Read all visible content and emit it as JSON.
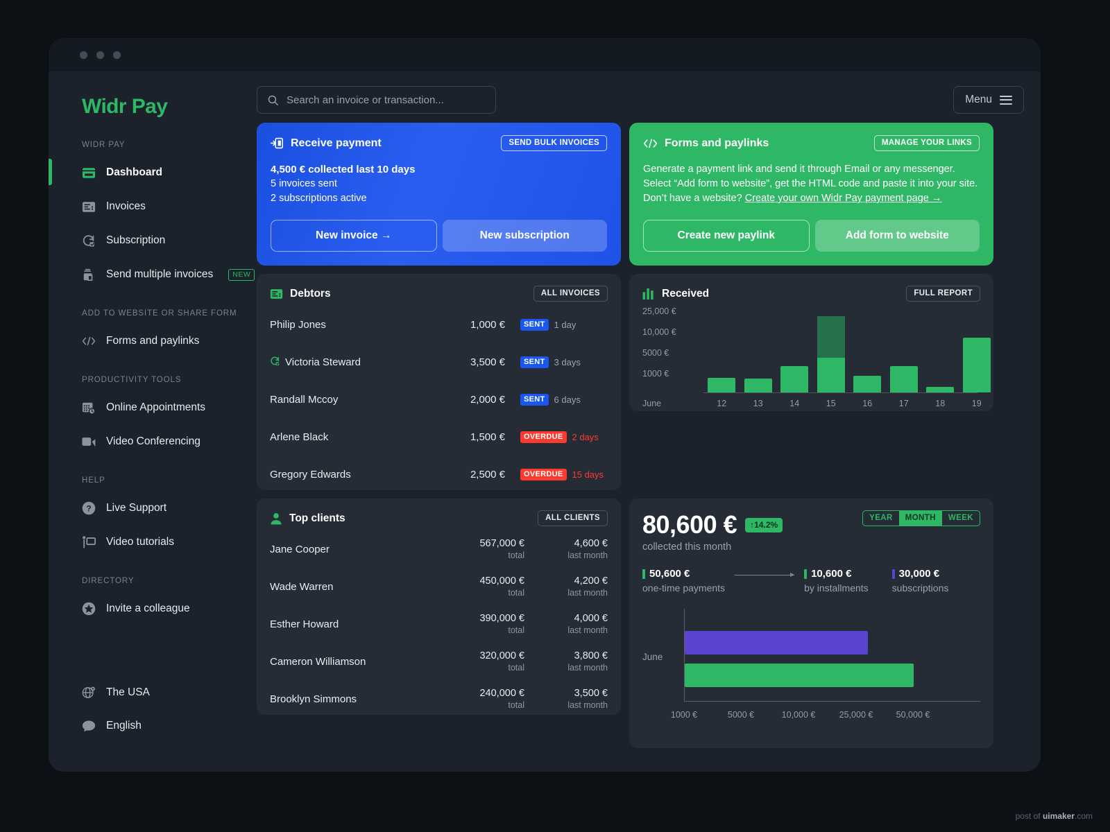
{
  "brand": {
    "name": "Widr Pay",
    "accent": "#2eb765",
    "blue": "#1a56f0",
    "red": "#fb3b30",
    "purple": "#5b45cf"
  },
  "search": {
    "placeholder": "Search an invoice or transaction...",
    "value": "",
    "icon": "search-icon"
  },
  "menu": {
    "label": "Menu",
    "icon": "hamburger-icon"
  },
  "sidebar": {
    "groups": [
      {
        "label": "WIDR PAY",
        "items": [
          {
            "label": "Dashboard",
            "icon": "dashboard-card-icon",
            "active": true,
            "badge": ""
          },
          {
            "label": "Invoices",
            "icon": "invoice-icon",
            "active": false,
            "badge": ""
          },
          {
            "label": "Subscription",
            "icon": "refresh-check-icon",
            "active": false,
            "badge": ""
          },
          {
            "label": "Send multiple invoices",
            "icon": "bulk-send-icon",
            "active": false,
            "badge": "NEW"
          }
        ]
      },
      {
        "label": "ADD TO WEBSITE OR SHARE FORM",
        "items": [
          {
            "label": "Forms and paylinks",
            "icon": "code-brackets-icon",
            "active": false,
            "badge": ""
          }
        ]
      },
      {
        "label": "PRODUCTIVITY TOOLS",
        "items": [
          {
            "label": "Online Appointments",
            "icon": "calendar-clock-icon",
            "active": false,
            "badge": ""
          },
          {
            "label": "Video Conferencing",
            "icon": "video-camera-icon",
            "active": false,
            "badge": ""
          }
        ]
      },
      {
        "label": "HELP",
        "items": [
          {
            "label": "Live Support",
            "icon": "question-circle-icon",
            "active": false,
            "badge": ""
          },
          {
            "label": "Video tutorials",
            "icon": "presenter-board-icon",
            "active": false,
            "badge": ""
          }
        ]
      },
      {
        "label": "DIRECTORY",
        "items": [
          {
            "label": "Invite a colleague",
            "icon": "star-circle-icon",
            "active": false,
            "badge": ""
          }
        ]
      }
    ],
    "footer": [
      {
        "label": "The USA",
        "icon": "globe-pin-icon"
      },
      {
        "label": "English",
        "icon": "speech-bubble-icon"
      }
    ]
  },
  "receive_payment": {
    "title": "Receive payment",
    "icon": "receive-payment-icon",
    "action_label": "SEND BULK INVOICES",
    "headline": "4,500 € collected last 10 days",
    "line2": "5 invoices sent",
    "line3": "2 subscriptions active",
    "primary_label": "New invoice →",
    "secondary_label": "New subscription"
  },
  "forms_paylinks": {
    "title": "Forms and paylinks",
    "icon": "code-brackets-icon",
    "action_label": "MANAGE YOUR LINKS",
    "line1": "Generate a payment link and send it through Email or any messenger.",
    "line2": "Select “Add form to website”, get the HTML code and paste it into your site.",
    "line3_prefix": "Don’t have a website? ",
    "line3_link": "Create your own Widr Pay payment page →",
    "primary_label": "Create new paylink",
    "secondary_label": "Add form to website"
  },
  "debtors": {
    "title": "Debtors",
    "icon": "invoice-icon",
    "action_label": "ALL INVOICES",
    "rows": [
      {
        "name": "Philip Jones",
        "amount": "1,000 €",
        "status": "SENT",
        "status_kind": "sent",
        "age": "1 day",
        "recurring": false
      },
      {
        "name": "Victoria Steward",
        "amount": "3,500 €",
        "status": "SENT",
        "status_kind": "sent",
        "age": "3 days",
        "recurring": true
      },
      {
        "name": "Randall Mccoy",
        "amount": "2,000 €",
        "status": "SENT",
        "status_kind": "sent",
        "age": "6 days",
        "recurring": false
      },
      {
        "name": "Arlene Black",
        "amount": "1,500 €",
        "status": "OVERDUE",
        "status_kind": "overdue",
        "age": "2 days",
        "recurring": false
      },
      {
        "name": "Gregory Edwards",
        "amount": "2,500 €",
        "status": "OVERDUE",
        "status_kind": "overdue",
        "age": "15 days",
        "recurring": false
      }
    ]
  },
  "top_clients": {
    "title": "Top clients",
    "icon": "person-icon",
    "action_label": "ALL CLIENTS",
    "total_caption": "total",
    "last_month_caption": "last month",
    "rows": [
      {
        "name": "Jane Cooper",
        "total": "567,000 €",
        "last_month": "4,600 €"
      },
      {
        "name": "Wade Warren",
        "total": "450,000 €",
        "last_month": "4,200 €"
      },
      {
        "name": "Esther Howard",
        "total": "390,000 €",
        "last_month": "4,000 €"
      },
      {
        "name": "Cameron Williamson",
        "total": "320,000 €",
        "last_month": "3,800 €"
      },
      {
        "name": "Brooklyn Simmons",
        "total": "240,000 €",
        "last_month": "3,500 €"
      }
    ]
  },
  "received": {
    "title": "Received",
    "icon": "bar-chart-icon",
    "action_label": "FULL REPORT"
  },
  "summary": {
    "amount": "80,600 €",
    "delta": "↑14.2%",
    "caption": "collected this month",
    "ranges": [
      {
        "label": "YEAR",
        "selected": false
      },
      {
        "label": "MONTH",
        "selected": true
      },
      {
        "label": "WEEK",
        "selected": false
      }
    ],
    "stats": [
      {
        "value": "50,600 €",
        "label": "one-time payments",
        "color": "#2eb765"
      },
      {
        "value": "10,600 €",
        "label": "by installments",
        "color": "#2eb765"
      },
      {
        "value": "30,000 €",
        "label": "subscriptions",
        "color": "#5b45cf"
      }
    ]
  },
  "chart_data": [
    {
      "type": "bar",
      "title": "Received",
      "xlabel": "June",
      "ylabel": "",
      "categories": [
        "12",
        "13",
        "14",
        "15",
        "16",
        "17",
        "18",
        "19"
      ],
      "tick_labels": [
        "1000 €",
        "5000 €",
        "10,000 €",
        "25,000 €"
      ],
      "axis_origin_label": "June",
      "grid": false,
      "legend": "none",
      "series": [
        {
          "name": "one-time payments",
          "color": "#2eb765",
          "values": [
            1200,
            1000,
            3400,
            5000,
            1600,
            3400,
            400,
            9800
          ]
        },
        {
          "name": "installments",
          "color": "#24714a",
          "values": [
            0,
            0,
            0,
            25000,
            0,
            0,
            0,
            0
          ]
        }
      ],
      "values": [
        1200,
        1000,
        3400,
        25000,
        1600,
        3400,
        400,
        9800
      ],
      "ylim": [
        0,
        25000
      ]
    },
    {
      "type": "bar",
      "orientation": "horizontal",
      "title": "",
      "categories": [
        "June"
      ],
      "tick_labels": [
        "1000 €",
        "5000 €",
        "10,000 €",
        "25,000 €",
        "50,000 €"
      ],
      "xlim": [
        0,
        50000
      ],
      "grid": false,
      "legend": "none",
      "series": [
        {
          "name": "subscriptions",
          "color": "#5b45cf",
          "values": [
            30000
          ]
        },
        {
          "name": "one-time payments",
          "color": "#2eb765",
          "values": [
            50600
          ]
        },
        {
          "name": "by installments",
          "color": "#24714a",
          "values": [
            10600
          ]
        }
      ]
    }
  ],
  "watermark": {
    "prefix": "post of ",
    "brand": "uimaker",
    "suffix": ".com"
  }
}
